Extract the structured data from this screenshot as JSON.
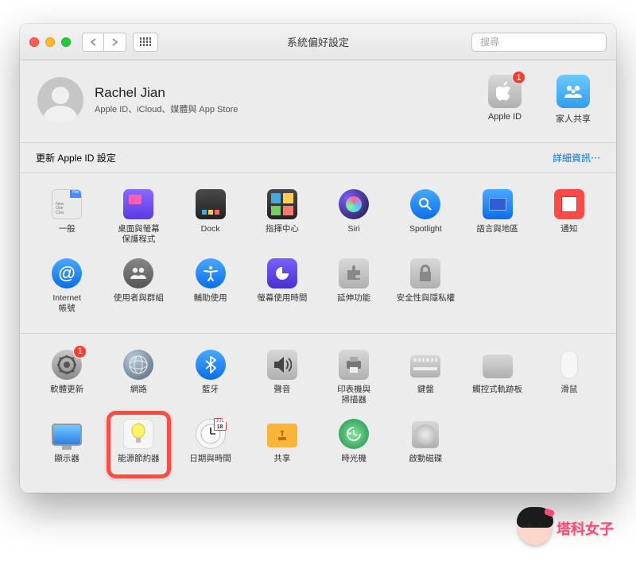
{
  "window": {
    "title": "系統偏好設定"
  },
  "search": {
    "placeholder": "搜尋"
  },
  "profile": {
    "name": "Rachel Jian",
    "subtitle": "Apple ID、iCloud、媒體與 App Store"
  },
  "side": {
    "apple_id": {
      "label": "Apple ID",
      "badge": "1"
    },
    "family": {
      "label": "家人共享"
    }
  },
  "notice": {
    "text": "更新 Apple ID 設定",
    "link": "詳細資訊⋯"
  },
  "row1": [
    {
      "id": "general",
      "label": "一般"
    },
    {
      "id": "desktop",
      "label": "桌面與螢幕\n保護程式"
    },
    {
      "id": "dock",
      "label": "Dock"
    },
    {
      "id": "mission",
      "label": "指揮中心"
    },
    {
      "id": "siri",
      "label": "Siri"
    },
    {
      "id": "spotlight",
      "label": "Spotlight"
    },
    {
      "id": "language",
      "label": "語言與地區"
    },
    {
      "id": "notifications",
      "label": "通知"
    }
  ],
  "row2": [
    {
      "id": "internet",
      "label": "Internet\n帳號"
    },
    {
      "id": "users",
      "label": "使用者與群組"
    },
    {
      "id": "accessibility",
      "label": "輔助使用"
    },
    {
      "id": "screentime",
      "label": "螢幕使用時間"
    },
    {
      "id": "extensions",
      "label": "延伸功能"
    },
    {
      "id": "security",
      "label": "安全性與隱私權"
    }
  ],
  "row3": [
    {
      "id": "software",
      "label": "軟體更新",
      "badge": "1"
    },
    {
      "id": "network",
      "label": "網路"
    },
    {
      "id": "bluetooth",
      "label": "藍牙"
    },
    {
      "id": "sound",
      "label": "聲音"
    },
    {
      "id": "printers",
      "label": "印表機與\n掃描器"
    },
    {
      "id": "keyboard",
      "label": "鍵盤"
    },
    {
      "id": "trackpad",
      "label": "觸控式軌跡板"
    },
    {
      "id": "mouse",
      "label": "滑鼠"
    }
  ],
  "row4": [
    {
      "id": "displays",
      "label": "顯示器"
    },
    {
      "id": "energy",
      "label": "能源節約器",
      "highlight": true
    },
    {
      "id": "datetime",
      "label": "日期與時間"
    },
    {
      "id": "sharing",
      "label": "共享"
    },
    {
      "id": "timemachine",
      "label": "時光機"
    },
    {
      "id": "startup",
      "label": "啟動磁碟"
    }
  ],
  "watermark": "塔科女子"
}
